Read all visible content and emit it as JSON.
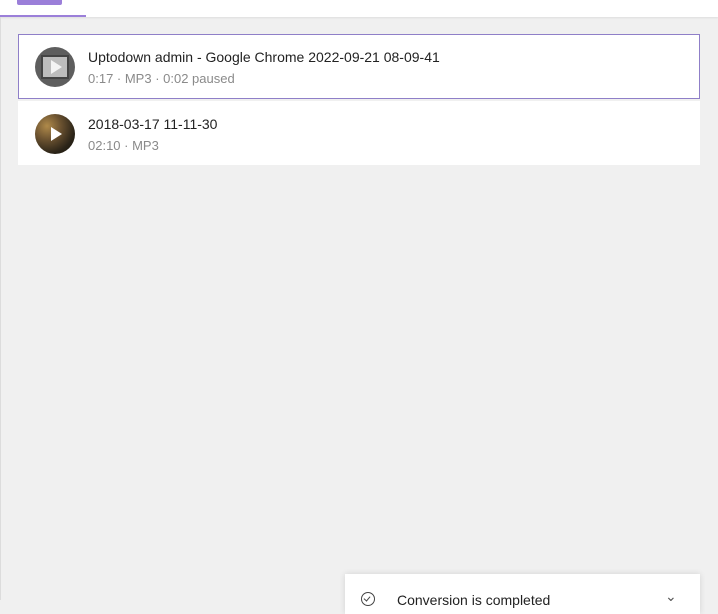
{
  "colors": {
    "accent": "#9b7fd9",
    "selected_border": "#8f7fc8",
    "background": "#f0f0f0"
  },
  "items": [
    {
      "title": "Uptodown admin - Google Chrome 2022-09-21 08-09-41",
      "meta": "0:17 · MP3 · 0:02 paused",
      "thumbnail_icon": "video-thumbnail-play-icon",
      "selected": true
    },
    {
      "title": "2018-03-17 11-11-30",
      "meta": "02:10 · MP3",
      "thumbnail_icon": "photo-thumbnail-play-icon",
      "selected": false
    }
  ],
  "toast": {
    "icon": "check-circle-icon",
    "text": "Conversion is completed",
    "chevron": "chevron-down-icon"
  }
}
